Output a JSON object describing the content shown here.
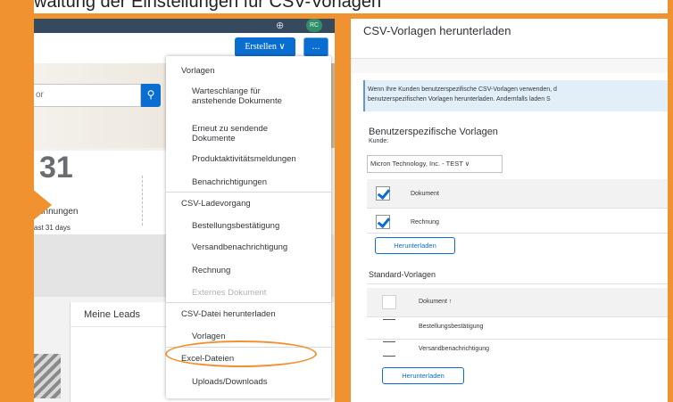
{
  "caption": "Verwaltung der Einstellungen für CSV-Vorlagen",
  "colors": {
    "accent_orange": "#f0922f",
    "brand_blue": "#0a6ed1",
    "shell": "#354a5f"
  },
  "shell": {
    "avatar_initials": "RC"
  },
  "toolbar": {
    "erstellen_label": "Erstellen ∨",
    "more_label": "..."
  },
  "search": {
    "placeholder": "or",
    "button_icon": "search-icon"
  },
  "kpi": {
    "value": "31",
    "label": "echnungen",
    "sub": "ast 31 days"
  },
  "leads": {
    "title": "Meine Leads"
  },
  "menu": {
    "sections": [
      {
        "heading": "Vorlagen",
        "items": [
          {
            "label": "Warteschlange für\nanstehende Dokumente",
            "disabled": false
          },
          {
            "label": "Erneut zu sendende\nDokumente",
            "disabled": false
          },
          {
            "label": "Produktaktivitätsmeldungen",
            "disabled": false
          },
          {
            "label": "Benachrichtigungen",
            "disabled": false
          }
        ]
      },
      {
        "heading": "CSV-Ladevorgang",
        "items": [
          {
            "label": "Bestellungsbestätigung",
            "disabled": false
          },
          {
            "label": "Versandbenachrichtigung",
            "disabled": false
          },
          {
            "label": "Rechnung",
            "disabled": false
          },
          {
            "label": "Externes Dokument",
            "disabled": true
          }
        ]
      },
      {
        "heading": "CSV-Datei herunterladen",
        "items": [
          {
            "label": "Vorlagen",
            "disabled": false
          }
        ]
      },
      {
        "heading": "Excel-Dateien",
        "items": [
          {
            "label": "Uploads/Downloads",
            "disabled": false
          }
        ]
      }
    ]
  },
  "right": {
    "title": "CSV-Vorlagen herunterladen",
    "info_line1": "Wenn Ihre Kunden benutzerspezifische CSV-Vorlagen verwenden, d",
    "info_line2": "benutzerspezifischen Vorlagen herunterladen. Andernfalls laden S",
    "custom_heading": "Benutzerspezifische Vorlagen",
    "kunde_label": "Kunde:",
    "kunde_value": "Micron Technology, Inc. - TEST ∨",
    "custom_rows": [
      {
        "label": "Dokument",
        "checked": true
      },
      {
        "label": "Rechnung",
        "checked": true
      }
    ],
    "download_label": "Herunterladen",
    "standard_heading": "Standard-Vorlagen",
    "standard_header": "Dokument ↑",
    "standard_rows": [
      "Bestellungsbestätigung",
      "Versandbenachrichtigung"
    ],
    "download_label2": "Herunterladen"
  }
}
